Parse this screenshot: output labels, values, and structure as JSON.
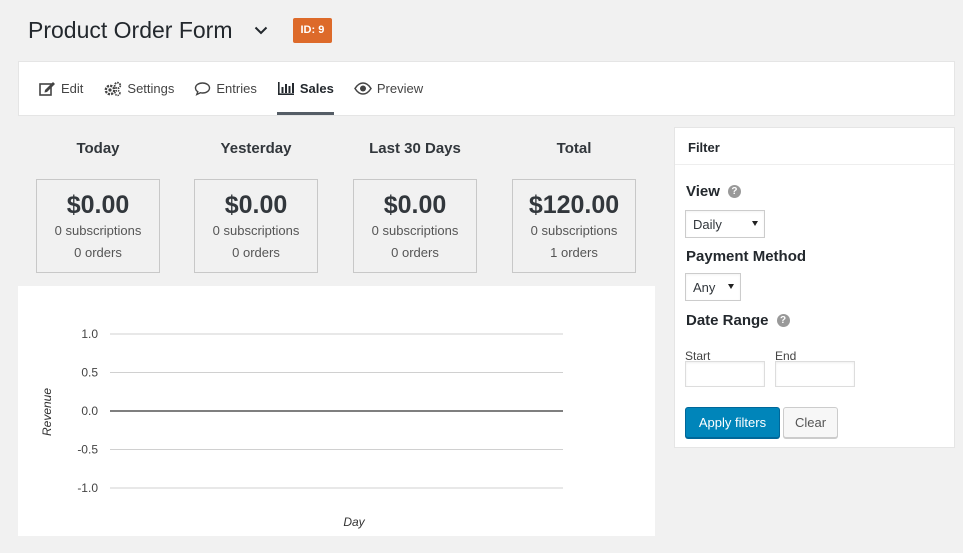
{
  "header": {
    "title": "Product Order Form",
    "id_badge": "ID: 9",
    "badge_color": "#dd6a2a"
  },
  "tabs": [
    {
      "label": "Edit",
      "icon": "edit-icon",
      "active": false
    },
    {
      "label": "Settings",
      "icon": "gears-icon",
      "active": false
    },
    {
      "label": "Entries",
      "icon": "speech-bubble-icon",
      "active": false
    },
    {
      "label": "Sales",
      "icon": "bar-chart-icon",
      "active": true
    },
    {
      "label": "Preview",
      "icon": "eye-icon",
      "active": false
    }
  ],
  "stats": [
    {
      "label": "Today",
      "amount": "$0.00",
      "subscriptions": "0 subscriptions",
      "orders": "0 orders"
    },
    {
      "label": "Yesterday",
      "amount": "$0.00",
      "subscriptions": "0 subscriptions",
      "orders": "0 orders"
    },
    {
      "label": "Last 30 Days",
      "amount": "$0.00",
      "subscriptions": "0 subscriptions",
      "orders": "0 orders"
    },
    {
      "label": "Total",
      "amount": "$120.00",
      "subscriptions": "0 subscriptions",
      "orders": "1 orders"
    }
  ],
  "chart_data": {
    "type": "line",
    "title": "",
    "xlabel": "Day",
    "ylabel": "Revenue",
    "ylim": [
      -1.0,
      1.0
    ],
    "yticks": [
      "1.0",
      "0.5",
      "0.0",
      "-0.5",
      "-1.0"
    ],
    "x": [],
    "series": [
      {
        "values": []
      }
    ],
    "grid": true,
    "zero_line": true
  },
  "filter": {
    "title": "Filter",
    "view_label": "View",
    "view_value": "Daily",
    "payment_label": "Payment Method",
    "payment_value": "Any",
    "date_range_label": "Date Range",
    "start_label": "Start",
    "end_label": "End",
    "start_value": "",
    "end_value": "",
    "apply_label": "Apply filters",
    "clear_label": "Clear",
    "primary_color": "#0085ba"
  }
}
